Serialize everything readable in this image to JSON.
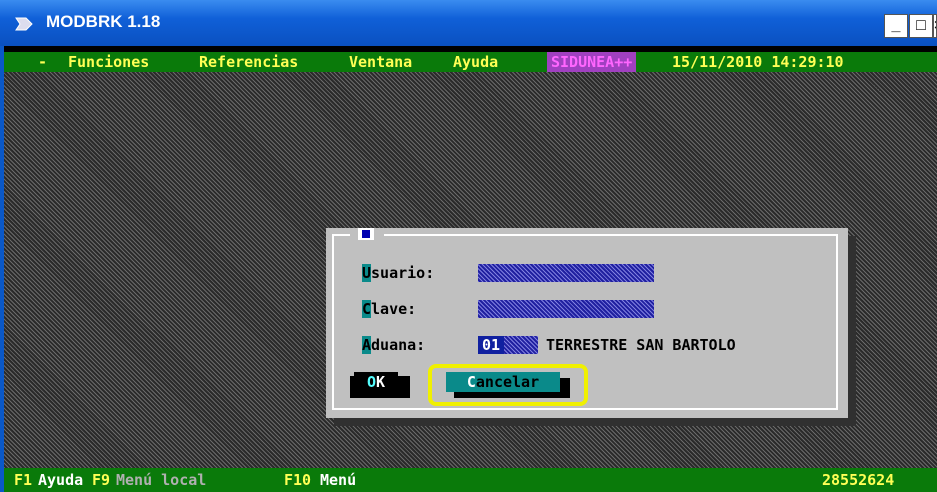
{
  "window": {
    "title": "MODBRK 1.18",
    "controls": {
      "minimize": "_",
      "maximize": "□",
      "close": "×"
    }
  },
  "menubar": {
    "system": "-",
    "items": [
      "Funciones",
      "Referencias",
      "Ventana",
      "Ayuda"
    ],
    "badge": "SIDUNEA++",
    "datetime": "15/11/2010 14:29:10"
  },
  "dialog": {
    "fields": {
      "usuario": {
        "hotkey": "U",
        "rest": "suario:"
      },
      "clave": {
        "hotkey": "C",
        "rest": "lave:"
      },
      "aduana": {
        "hotkey": "A",
        "rest": "duana:",
        "code": "01",
        "description": "TERRESTRE SAN BARTOLO"
      }
    },
    "buttons": {
      "ok": {
        "hotkey": "O",
        "rest": "K"
      },
      "cancel": {
        "hotkey": "C",
        "rest": "ancelar"
      }
    }
  },
  "statusbar": {
    "f1_key": "F1",
    "f1_label": "Ayuda",
    "f9_key": "F9",
    "f9_label": "Menú local",
    "f10_key": "F10",
    "f10_label": "Menú",
    "number": "28552624"
  },
  "colors": {
    "titlebar": "#0a58c8",
    "menubar": "#0a7a0a",
    "menu_text": "#ffff55",
    "badge_bg": "#a040c0",
    "dialog_bg": "#c0c0c0",
    "highlight": "#f0f000"
  }
}
